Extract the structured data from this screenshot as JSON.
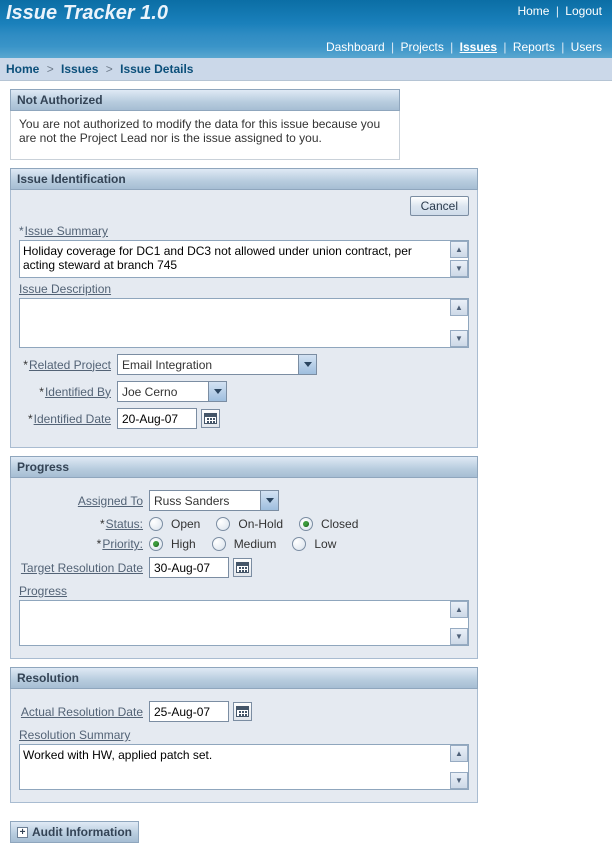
{
  "header": {
    "title": "Issue Tracker 1.0",
    "links1": [
      "Home",
      "Logout"
    ],
    "tabs": [
      "Dashboard",
      "Projects",
      "Issues",
      "Reports",
      "Users"
    ],
    "active_tab": "Issues"
  },
  "breadcrumb": {
    "items": [
      "Home",
      "Issues",
      "Issue Details"
    ]
  },
  "not_authorized": {
    "title": "Not Authorized",
    "body": "You are not authorized to modify the data for this issue because you are not the Project Lead nor is the issue assigned to you."
  },
  "identification": {
    "title": "Issue Identification",
    "cancel": "Cancel",
    "summary_label": "Issue Summary",
    "summary_value": "Holiday coverage for DC1 and DC3 not allowed under union contract, per acting steward at branch 745",
    "description_label": "Issue Description",
    "description_value": "",
    "related_project_label": "Related Project",
    "related_project_value": "Email Integration",
    "identified_by_label": "Identified By",
    "identified_by_value": "Joe Cerno",
    "identified_date_label": "Identified Date",
    "identified_date_value": "20-Aug-07"
  },
  "progress": {
    "title": "Progress",
    "assigned_to_label": "Assigned To",
    "assigned_to_value": "Russ Sanders",
    "status_label": "Status:",
    "status_options": [
      "Open",
      "On-Hold",
      "Closed"
    ],
    "status_value": "Closed",
    "priority_label": "Priority:",
    "priority_options": [
      "High",
      "Medium",
      "Low"
    ],
    "priority_value": "High",
    "target_date_label": "Target Resolution Date",
    "target_date_value": "30-Aug-07",
    "progress_label": "Progress",
    "progress_value": ""
  },
  "resolution": {
    "title": "Resolution",
    "actual_date_label": "Actual Resolution Date",
    "actual_date_value": "25-Aug-07",
    "summary_label": "Resolution Summary",
    "summary_value": "Worked with HW, applied patch set."
  },
  "audit": {
    "title": "Audit Information"
  }
}
